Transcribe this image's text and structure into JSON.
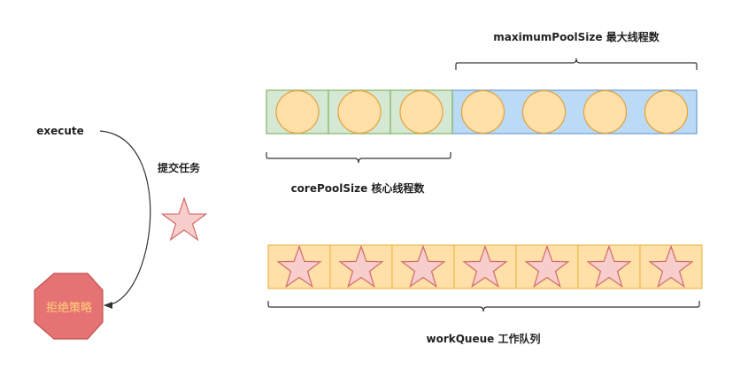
{
  "labels": {
    "maximum_pool": "maximumPoolSize 最大线程数",
    "core_pool": "corePoolSize 核心线程数",
    "execute": "execute",
    "submit_task": "提交任务",
    "work_queue": "workQueue 工作队列",
    "reject_policy": "拒绝策略"
  },
  "thread_pool": {
    "core_thread_count": 3,
    "max_thread_count": 7
  },
  "work_queue": {
    "task_count": 7
  },
  "colors": {
    "core_cell_fill": "#d5e8d4",
    "core_cell_stroke": "#82b366",
    "max_cell_fill": "#bbdaf5",
    "max_cell_stroke": "#6c9fd1",
    "thread_circle_fill": "#ffe0a8",
    "thread_circle_stroke": "#e6a23c",
    "queue_cell_fill": "#ffe0a8",
    "queue_cell_stroke": "#f0b84e",
    "task_star_fill": "#f8cecc",
    "task_star_stroke": "#d06a6a",
    "reject_fill": "#e67373",
    "reject_stroke": "#c0504d",
    "reject_text": "#ffd37a",
    "bracket_stroke": "#333333"
  },
  "icons": {
    "thread": "circle",
    "task": "star",
    "reject": "octagon"
  }
}
